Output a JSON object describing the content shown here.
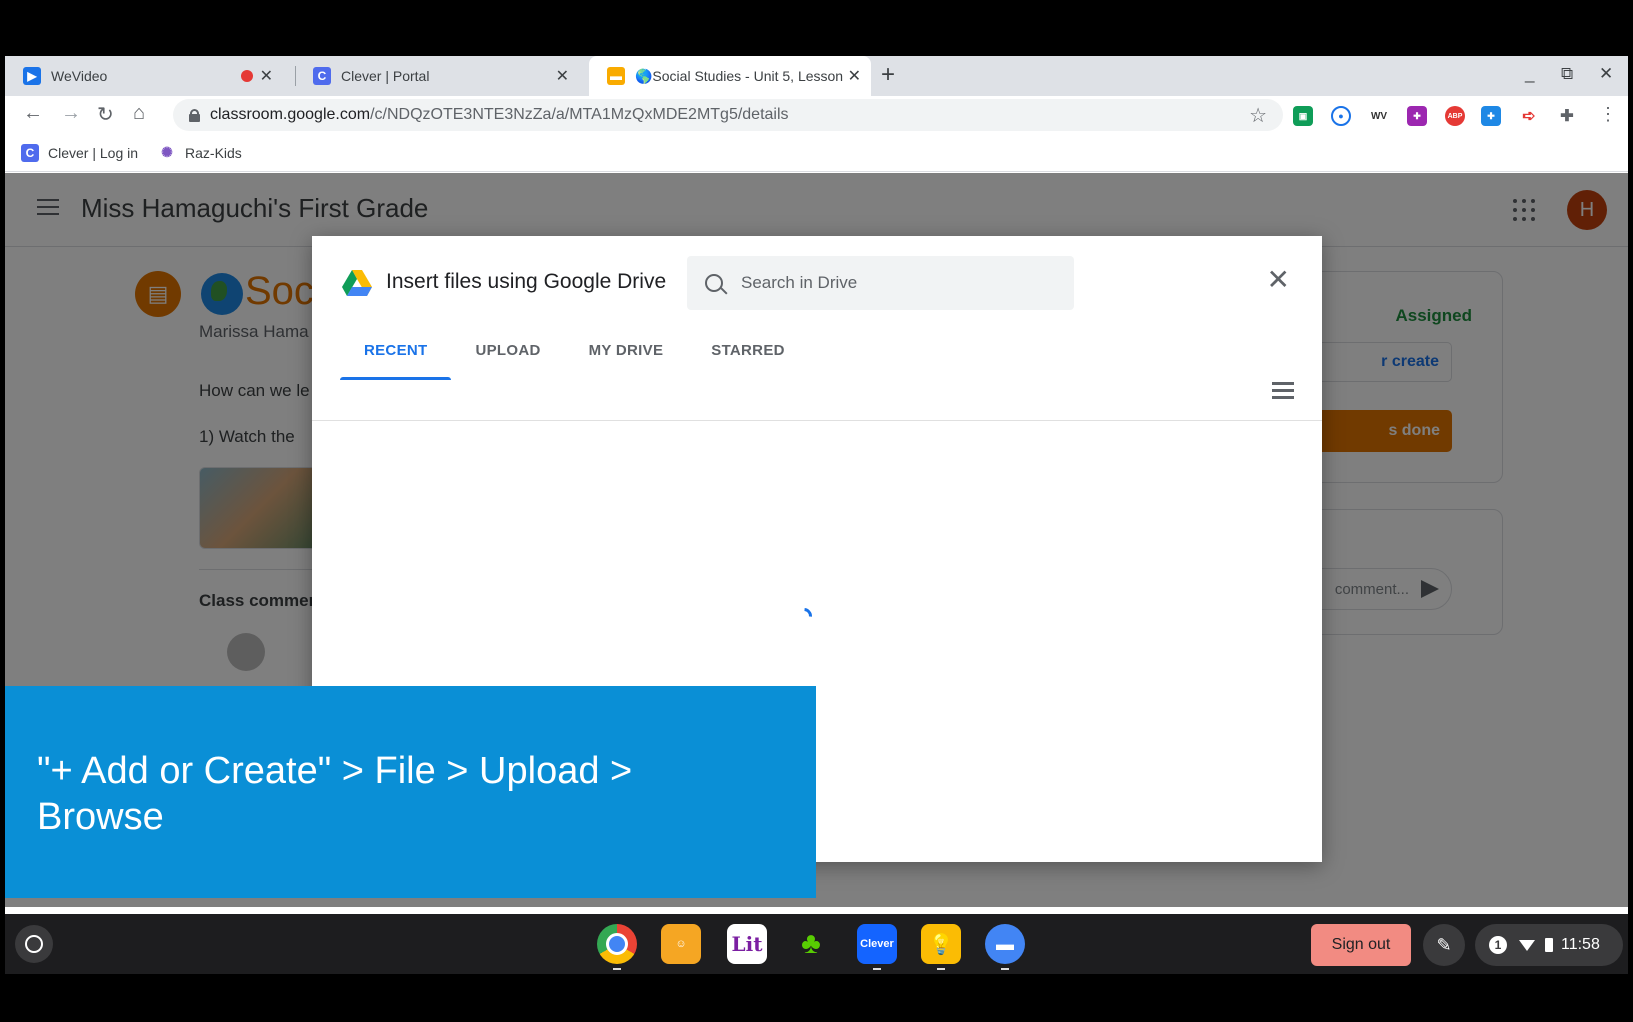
{
  "browser": {
    "tabs": [
      {
        "title": "WeVideo",
        "favicon": "wevideo-icon",
        "recording": true
      },
      {
        "title": "Clever | Portal",
        "favicon": "clever-icon"
      },
      {
        "title": "🌎Social Studies - Unit 5, Lesson",
        "favicon": "classroom-icon",
        "active": true
      }
    ],
    "url_host": "classroom.google.com",
    "url_path": "/c/NDQzOTE3NTE3NzZa/a/MTA1MzQxMDE2MTg5/details",
    "bookmarks": [
      {
        "label": "Clever | Log in",
        "icon": "clever-icon"
      },
      {
        "label": "Raz-Kids",
        "icon": "raz-kids-icon"
      }
    ],
    "extensions": [
      "classroom-ext-icon",
      "screencastify-icon",
      "wevideo-ext-icon",
      "puzzle-purple-icon",
      "adblock-plus-icon",
      "puzzle-blue-icon",
      "arrow-ext-icon",
      "extensions-icon"
    ]
  },
  "classroom": {
    "class_name": "Miss Hamaguchi's First Grade",
    "avatar_letter": "H",
    "assignment_title": "Soc",
    "author": "Marissa Hama",
    "line1": "How can we le",
    "line2": "1) Watch the",
    "class_comments": "Class commer",
    "status": "Assigned",
    "create_label": "r create",
    "done_label": "s done",
    "comment_placeholder": "comment..."
  },
  "picker": {
    "title": "Insert files using Google Drive",
    "search_placeholder": "Search in Drive",
    "tabs": [
      "RECENT",
      "UPLOAD",
      "MY DRIVE",
      "STARRED"
    ],
    "active_tab": "RECENT"
  },
  "caption": {
    "line1": "\"+ Add or Create\" > File > Upload >",
    "line2": "Browse"
  },
  "shelf": {
    "apps": [
      "chrome-icon",
      "epic-icon",
      "lit-icon",
      "duolingo-icon",
      "clever-app-icon",
      "keep-icon",
      "files-icon"
    ],
    "clever_label": "Clever",
    "signout_label": "Sign out",
    "time": "11:58",
    "info_badge": "1"
  }
}
